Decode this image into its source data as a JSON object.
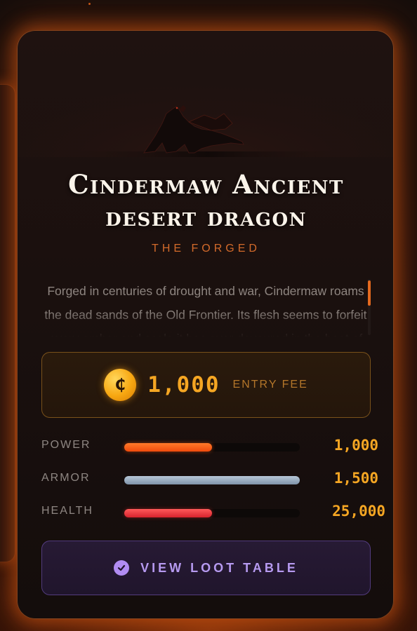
{
  "card": {
    "title_line1": "Cindermaw Ancient",
    "title_line2": "desert dragon",
    "subtitle": "THE FORGED",
    "lore": "Forged in centuries of drought and war, Cindermaw roams the dead sands of the Old Frontier. Its flesh seems to forfeit every ember and scale it has ever devoured in the heat of battle."
  },
  "fee": {
    "coin_symbol": "₵",
    "amount": "1,000",
    "label": "ENTRY FEE"
  },
  "stats": [
    {
      "label": "POWER",
      "value": "1,000",
      "fill": 0.5
    },
    {
      "label": "ARMOR",
      "value": "1,500",
      "fill": 1.0
    },
    {
      "label": "HEALTH",
      "value": "25,000",
      "fill": 0.5
    }
  ],
  "loot_button": {
    "label": "VIEW LOOT TABLE"
  },
  "colors": {
    "accent_orange": "#d36a2a",
    "gold": "#f5a623",
    "power_bar": "#f04a0c",
    "armor_bar": "#9fb0c4",
    "health_bar": "#e0303a",
    "loot_purple": "#b18cf2"
  },
  "icons": {
    "coin": "coin-icon",
    "loot": "check-circle-icon"
  }
}
